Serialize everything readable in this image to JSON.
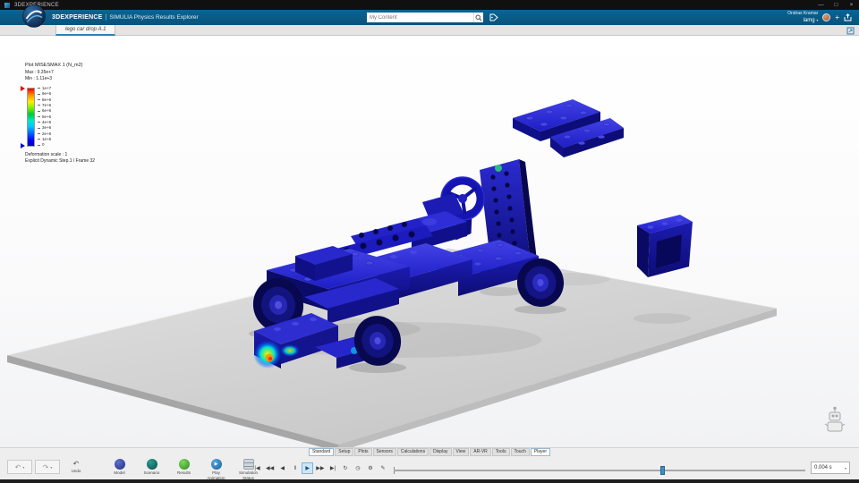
{
  "window": {
    "title": "3DEXPERIENCE",
    "minimize_glyph": "—",
    "maximize_glyph": "□",
    "close_glyph": "×"
  },
  "topbar": {
    "brand": "3DEXPERIENCE",
    "separator": "|",
    "app_name": "SIMULIA Physics Results Explorer",
    "search_placeholder": "My Content",
    "user_name": "Ondras Kramar",
    "add_glyph": "+",
    "workspace": "lamg",
    "caret_glyph": "▾"
  },
  "tabbar": {
    "active_tab": "lego car drop A.1"
  },
  "legend": {
    "plot_title": "Plot MISESMAX 1 (N_m2)",
    "max_label": "Max : 9.35e+7",
    "min_label": "Min : 1.11e+3",
    "ticks": [
      "1e+7",
      "9e+6",
      "8e+6",
      "7e+6",
      "6e+6",
      "5e+6",
      "4e+6",
      "3e+6",
      "2e+6",
      "1e+6",
      "0"
    ],
    "deformation_label": "Deformation scale : 1",
    "frame_label": "Explicit Dynamic Step.1 / Frame 32"
  },
  "ribbon": {
    "tabs": [
      "Standard",
      "Setup",
      "Plots",
      "Sensors",
      "Calculations",
      "Display",
      "View",
      "AR-VR",
      "Tools",
      "Touch",
      "Player"
    ]
  },
  "toolbar": {
    "undo_glyph": "↶",
    "redo_glyph": "↷",
    "caret_glyph": "▾",
    "undo_label": "Undo",
    "apps": [
      {
        "label1": "Model",
        "label2": ""
      },
      {
        "label1": "Scenario",
        "label2": ""
      },
      {
        "label1": "Results",
        "label2": ""
      },
      {
        "label1": "Play",
        "label2": "Animation"
      },
      {
        "label1": "Simulation",
        "label2": "Status"
      }
    ]
  },
  "player": {
    "buttons": [
      {
        "name": "skip-to-start",
        "glyph": "|◀"
      },
      {
        "name": "fast-rewind",
        "glyph": "◀◀"
      },
      {
        "name": "step-back",
        "glyph": "◀"
      },
      {
        "name": "pause",
        "glyph": "‖"
      },
      {
        "name": "play",
        "glyph": "▶"
      },
      {
        "name": "fast-forward",
        "glyph": "▶▶"
      },
      {
        "name": "skip-to-end",
        "glyph": "▶|"
      },
      {
        "name": "loop",
        "glyph": "↻"
      },
      {
        "name": "time-settings",
        "glyph": "◷"
      },
      {
        "name": "player-settings",
        "glyph": "⚙"
      },
      {
        "name": "edit-animation",
        "glyph": "✎"
      }
    ],
    "time_value": "0.004 s",
    "caret_glyph": "▾"
  },
  "icons": {
    "search": "magnifier",
    "tag": "bookmark-tag",
    "share": "share-arrow",
    "expand": "expand-corners",
    "compass": "3ds-compass",
    "assistant": "robot"
  }
}
